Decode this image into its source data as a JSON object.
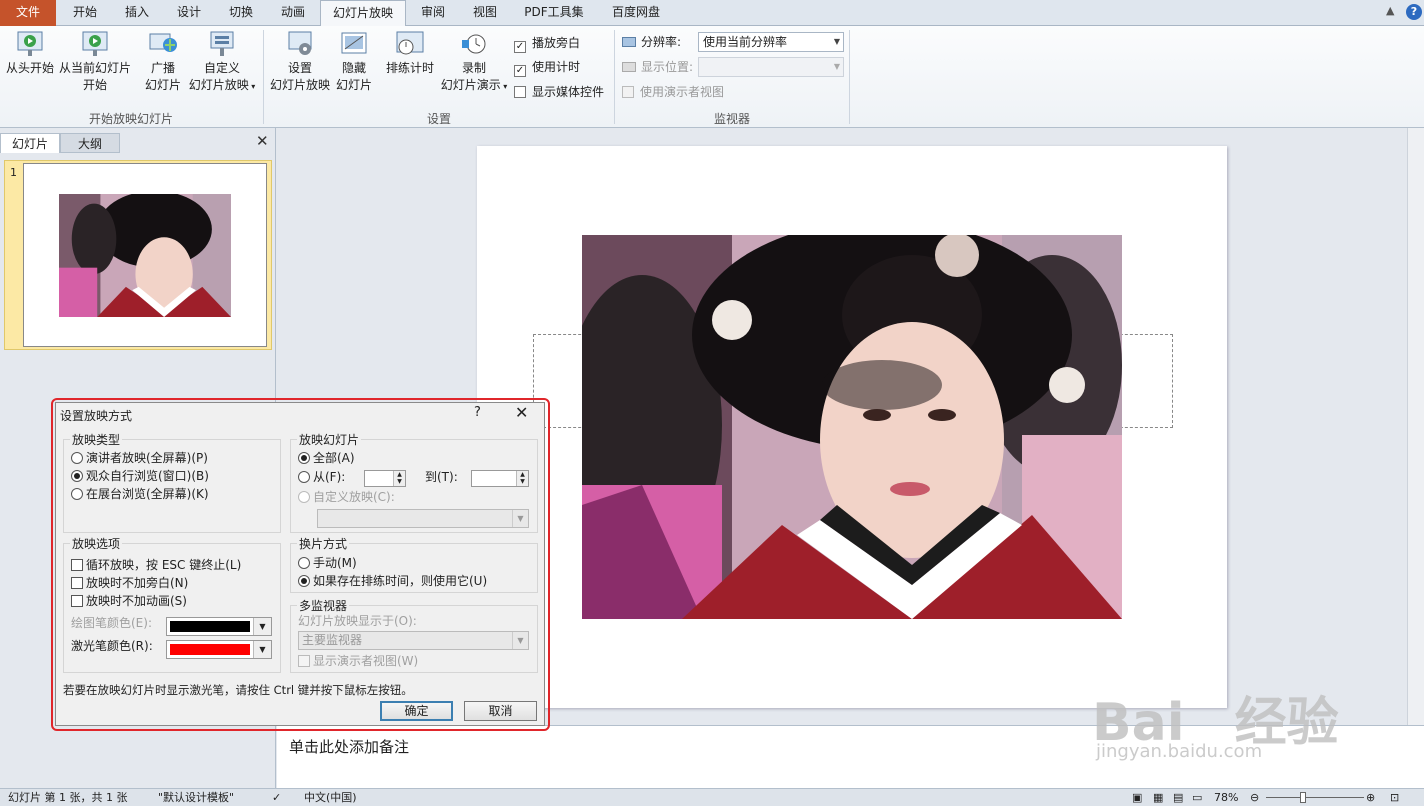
{
  "tabs": [
    "文件",
    "开始",
    "插入",
    "设计",
    "切换",
    "动画",
    "幻灯片放映",
    "审阅",
    "视图",
    "PDF工具集",
    "百度网盘"
  ],
  "ribbon": {
    "start_group": {
      "label": "开始放映幻灯片",
      "from_beginning": "从头开始",
      "from_current_l1": "从当前幻灯片",
      "from_current_l2": "开始",
      "broadcast_l1": "广播",
      "broadcast_l2": "幻灯片",
      "custom_l1": "自定义",
      "custom_l2": "幻灯片放映"
    },
    "setup_group": {
      "label": "设置",
      "setup_l1": "设置",
      "setup_l2": "幻灯片放映",
      "hide_l1": "隐藏",
      "hide_l2": "幻灯片",
      "rehearse": "排练计时",
      "record_l1": "录制",
      "record_l2": "幻灯片演示",
      "play_narrations": "播放旁白",
      "use_timings": "使用计时",
      "show_media_controls": "显示媒体控件"
    },
    "monitor_group": {
      "label": "监视器",
      "resolution_label": "分辨率:",
      "resolution_value": "使用当前分辨率",
      "show_on_label": "显示位置:",
      "presenter_view": "使用演示者视图"
    }
  },
  "left_pane": {
    "tab_slides": "幻灯片",
    "tab_outline": "大纲",
    "slide_number": "1"
  },
  "notes_placeholder": "单击此处添加备注",
  "status": {
    "slide_info": "幻灯片 第 1 张，共 1 张",
    "theme": "\"默认设计模板\"",
    "language": "中文(中国)",
    "zoom": "78%"
  },
  "dialog": {
    "title": "设置放映方式",
    "help": "?",
    "close": "✕",
    "show_type": {
      "title": "放映类型",
      "options": [
        "演讲者放映(全屏幕)(P)",
        "观众自行浏览(窗口)(B)",
        "在展台浏览(全屏幕)(K)"
      ],
      "selected": 1
    },
    "show_slides": {
      "title": "放映幻灯片",
      "all": "全部(A)",
      "from": "从(F):",
      "to": "到(T):",
      "custom": "自定义放映(C):"
    },
    "show_options": {
      "title": "放映选项",
      "loop": "循环放映，按 ESC 键终止(L)",
      "no_narration": "放映时不加旁白(N)",
      "no_animation": "放映时不加动画(S)",
      "pen_color": "绘图笔颜色(E):",
      "laser_color": "激光笔颜色(R):",
      "pen_color_value": "#000000",
      "laser_color_value": "#ff0000"
    },
    "advance": {
      "title": "换片方式",
      "manual": "手动(M)",
      "use_timings": "如果存在排练时间，则使用它(U)"
    },
    "multi_monitor": {
      "title": "多监视器",
      "display_on": "幻灯片放映显示于(O):",
      "monitor_value": "主要监视器",
      "presenter_view": "显示演示者视图(W)"
    },
    "hint": "若要在放映幻灯片时显示激光笔，请按住 Ctrl 键并按下鼠标左按钮。",
    "ok": "确定",
    "cancel": "取消"
  },
  "watermark": {
    "brand": "Bai",
    "brand2": "经验",
    "url": "jingyan.baidu.com"
  }
}
